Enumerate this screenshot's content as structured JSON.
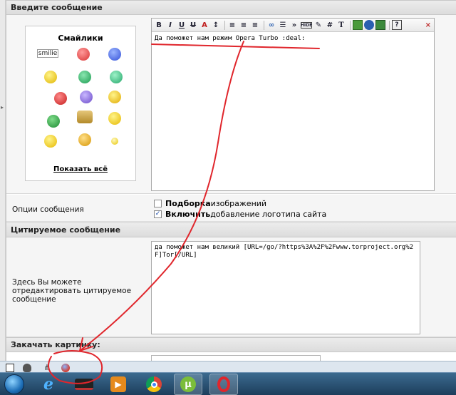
{
  "sections": {
    "message": "Введите сообщение",
    "quoted": "Цитируемое сообщение",
    "upload": "Закачать картинку:"
  },
  "smilies": {
    "title": "Смайлики",
    "first_label": "smilie",
    "show_all": "Показать всё"
  },
  "editor": {
    "text": "Да поможет нам режим Opera Turbo :deal:"
  },
  "options": {
    "label": "Опции сообщения",
    "option1_bold": "Подборка",
    "option1_rest": " изображений",
    "option2_bold": "Включить",
    "option2_rest": " добавление логотипа сайта"
  },
  "quote": {
    "label": "Здесь Вы можете отредактировать цитируемое сообщение",
    "text": "да поможет нам великий [URL=/go/?https%3A%2F%2Fwww.torproject.org%2F]Tor[/URL]"
  },
  "colors": {
    "annotation": "#e0262c",
    "taskbar": "#2a5275"
  }
}
